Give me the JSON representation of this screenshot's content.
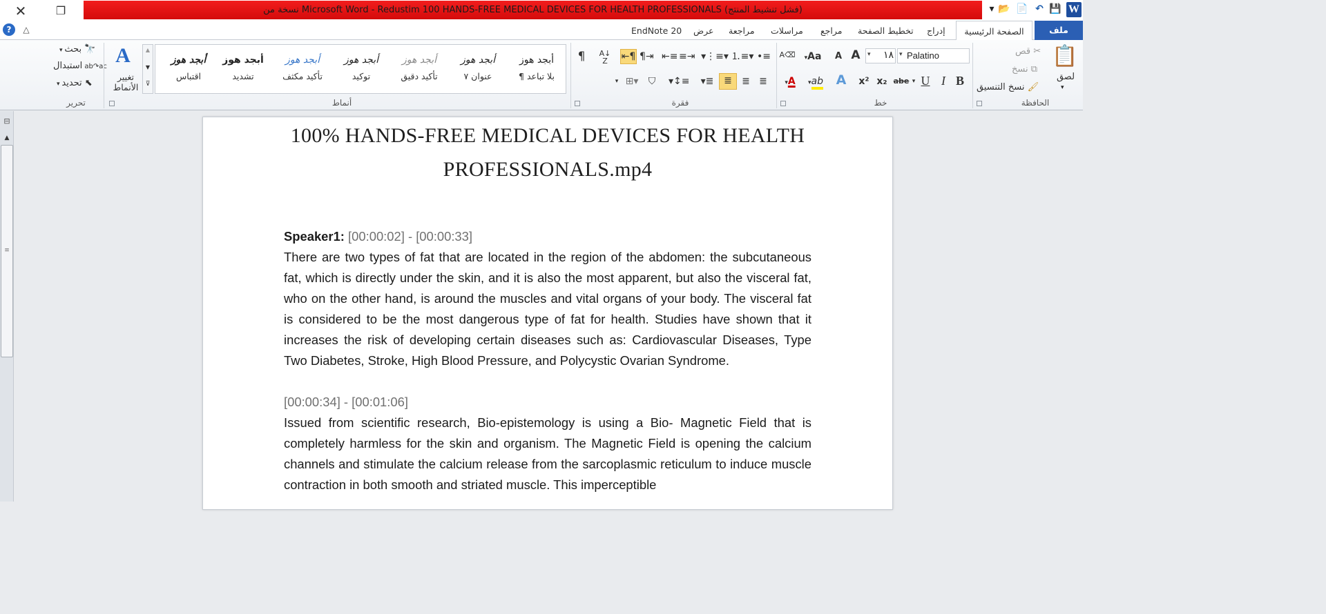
{
  "window": {
    "title": "نسخة من Microsoft Word  -  Redustim 100 HANDS-FREE MEDICAL DEVICES FOR HEALTH PROFESSIONALS (فشل تنشيط المنتج)",
    "close_glyph": "✕",
    "restore_glyph": "❐"
  },
  "quick_access": {
    "word_logo": "W",
    "save_icon": "💾",
    "undo_icon": "↶",
    "new_icon": "📄",
    "open_icon": "📂",
    "customize_icon": "▾"
  },
  "tabs": {
    "file": "ملف",
    "home": "الصفحة الرئيسية",
    "insert": "إدراج",
    "page_layout": "تخطيط الصفحة",
    "references": "مراجع",
    "mailings": "مراسلات",
    "review": "مراجعة",
    "view": "عرض",
    "endnote": "EndNote 20"
  },
  "help_icon": "?",
  "minimize_ribbon_icon": "△",
  "groups": {
    "clipboard": {
      "label": "الحافظة",
      "paste": "لصق",
      "cut": "قص",
      "copy": "نسخ",
      "format_painter": "نسخ التنسيق"
    },
    "font": {
      "label": "خط",
      "font_name": "Palatino",
      "font_size": "١٨",
      "grow": "A",
      "shrink": "A",
      "case": "Aa",
      "clear": "A",
      "bold": "B",
      "italic": "I",
      "underline": "U",
      "strike": "abe",
      "subscript": "x₂",
      "superscript": "x²",
      "text_effects": "A",
      "highlight": "ab",
      "font_color": "A"
    },
    "paragraph": {
      "label": "فقرة",
      "pilcrow": "¶"
    },
    "styles": {
      "label": "أنماط",
      "change_styles": "تغيير الأنماط",
      "items": [
        {
          "preview": "أبجد هوز",
          "name": "¶ بلا تباعد"
        },
        {
          "preview": "أبجد هوز",
          "name": "عنوان ٧"
        },
        {
          "preview": "أبجد هوز",
          "name": "تأكيد دقيق"
        },
        {
          "preview": "أبجد هوز",
          "name": "توكيد"
        },
        {
          "preview": "أبجد هوز",
          "name": "تأكيد مكثف"
        },
        {
          "preview": "أبجد هوز",
          "name": "تشديد"
        },
        {
          "preview": "أبجد هوز",
          "name": "اقتباس"
        }
      ]
    },
    "editing": {
      "label": "تحرير",
      "find": "بحث",
      "replace": "استبدال",
      "select": "تحديد"
    }
  },
  "document": {
    "title": "100% HANDS-FREE MEDICAL DEVICES FOR HEALTH PROFESSIONALS.mp4",
    "speaker": "Speaker1:",
    "ts1": "[00:00:02] - [00:00:33]",
    "p1": "There are two types of fat that are located in the region of the abdomen: the subcutaneous fat, which is directly under the skin, and it is also the most apparent, but also the visceral fat, who on the other hand, is around the muscles and vital organs of your body. The visceral fat is considered to be the most dangerous type of fat for health. Studies have shown that it increases the risk of developing certain diseases such as: Cardiovascular Diseases, Type Two Diabetes, Stroke, High Blood Pressure, and Polycystic Ovarian Syndrome.",
    "ts2": "[00:00:34] - [00:01:06]",
    "p2": "Issued from scientific research, Bio-epistemology is using a Bio- Magnetic Field that is completely harmless for the skin and organism. The Magnetic Field is opening the calcium channels and stimulate the calcium release from the sarcoplasmic reticulum to induce muscle contraction in both smooth and striated muscle. This imperceptible"
  }
}
